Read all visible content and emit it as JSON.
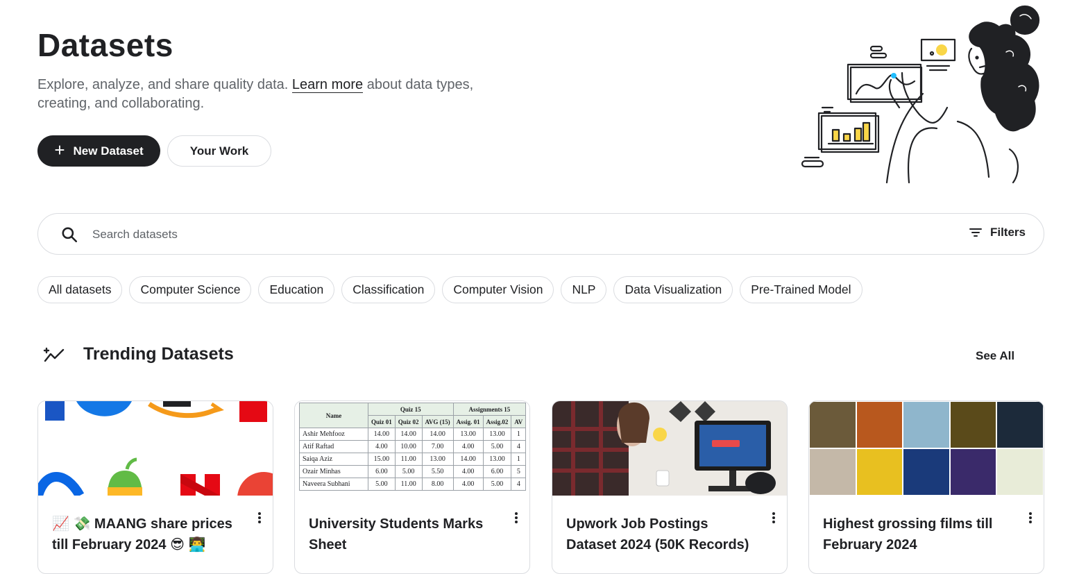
{
  "header": {
    "title": "Datasets",
    "subtitle_pre": "Explore, analyze, and share quality data. ",
    "learn_more": "Learn more",
    "subtitle_post": " about data types, creating, and collaborating.",
    "new_dataset": "New Dataset",
    "your_work": "Your Work"
  },
  "search": {
    "placeholder": "Search datasets",
    "filters_label": "Filters"
  },
  "chips": [
    "All datasets",
    "Computer Science",
    "Education",
    "Classification",
    "Computer Vision",
    "NLP",
    "Data Visualization",
    "Pre-Trained Model"
  ],
  "trending": {
    "title": "Trending Datasets",
    "see_all": "See All"
  },
  "cards": [
    {
      "title": "📈 💸 MAANG share prices till February 2024 😎 👨‍💻"
    },
    {
      "title": "University Students Marks Sheet"
    },
    {
      "title": "Upwork Job Postings Dataset 2024 (50K Records)"
    },
    {
      "title": "Highest grossing films till February 2024"
    }
  ],
  "marks_table": {
    "name_header": "Name",
    "group1": "Quiz 15",
    "group2": "Assignments 15",
    "cols": [
      "Quiz 01",
      "Quiz 02",
      "AVG (15)",
      "Assig. 01",
      "Assig.02",
      "AV"
    ],
    "rows": [
      [
        "Ashir Mehfooz",
        "14.00",
        "14.00",
        "14.00",
        "13.00",
        "13.00",
        "1"
      ],
      [
        "Atif Raftad",
        "4.00",
        "10.00",
        "7.00",
        "4.00",
        "5.00",
        "4"
      ],
      [
        "Saiqa Aziz",
        "15.00",
        "11.00",
        "13.00",
        "14.00",
        "13.00",
        "1"
      ],
      [
        "Ozair Minhas",
        "6.00",
        "5.00",
        "5.50",
        "4.00",
        "6.00",
        "5"
      ],
      [
        "Naveera Subhani",
        "5.00",
        "11.00",
        "8.00",
        "4.00",
        "5.00",
        "4"
      ]
    ]
  },
  "colors": {
    "primary_button": "#202124",
    "border": "#dadce0",
    "muted_text": "#5f6368",
    "accent_yellow": "#f9d648",
    "accent_blue": "#20beff"
  }
}
